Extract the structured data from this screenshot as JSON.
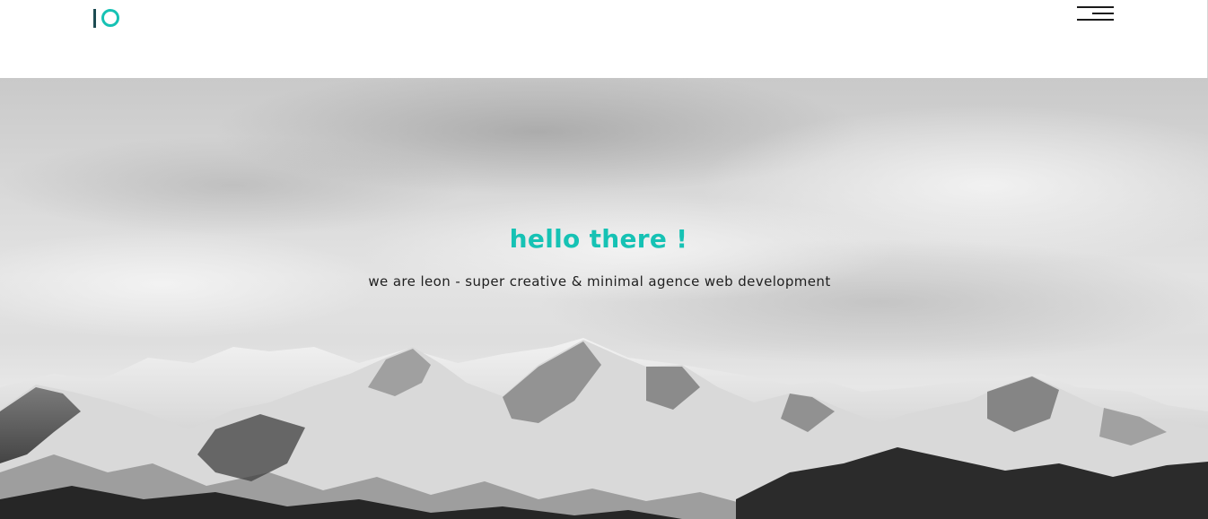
{
  "header": {
    "logo_icon": "io-logo-icon",
    "menu_icon": "hamburger-menu-icon"
  },
  "hero": {
    "title": "hello there !",
    "subtitle": "we are leon - super creative & minimal agence web development",
    "background_image": "grayscale snowy mountain range under cloudy sky"
  },
  "colors": {
    "accent": "#16c2b4",
    "brand_dark": "#1d4b52",
    "text": "#1f1f1f",
    "background": "#ffffff"
  }
}
